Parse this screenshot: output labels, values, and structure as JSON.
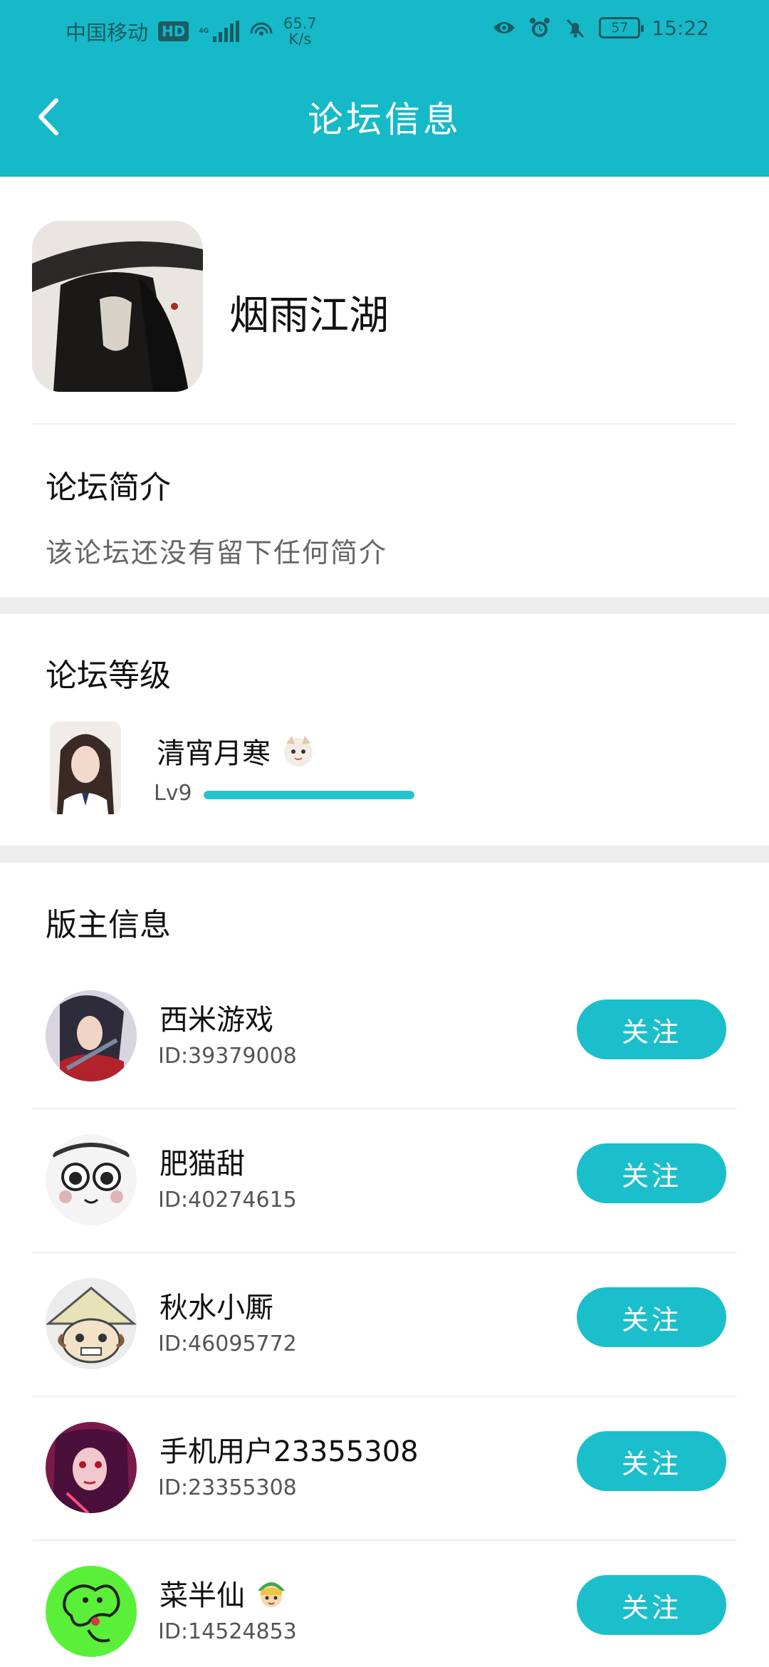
{
  "status_bar": {
    "carrier": "中国移动",
    "hd": "HD",
    "network": "4G",
    "speed_value": "65.7",
    "speed_unit": "K/s",
    "battery": "57",
    "time": "15:22"
  },
  "header": {
    "title": "论坛信息",
    "back_icon": "chevron-left-icon"
  },
  "forum": {
    "name": "烟雨江湖"
  },
  "intro": {
    "title": "论坛简介",
    "text": "该论坛还没有留下任何简介"
  },
  "level": {
    "title": "论坛等级",
    "user_name": "清宵月寒",
    "level_label": "Lv9",
    "progress": 1.0
  },
  "moderators": {
    "title": "版主信息",
    "follow_label": "关注",
    "items": [
      {
        "name": "西米游戏",
        "id": "ID:39379008"
      },
      {
        "name": "肥猫甜",
        "id": "ID:40274615"
      },
      {
        "name": "秋水小厮",
        "id": "ID:46095772"
      },
      {
        "name": "手机用户23355308",
        "id": "ID:23355308"
      },
      {
        "name": "菜半仙",
        "id": "ID:14524853"
      }
    ]
  },
  "colors": {
    "brand": "#15b9c8",
    "button": "#1bbfcc",
    "separator": "#eeeeee"
  }
}
